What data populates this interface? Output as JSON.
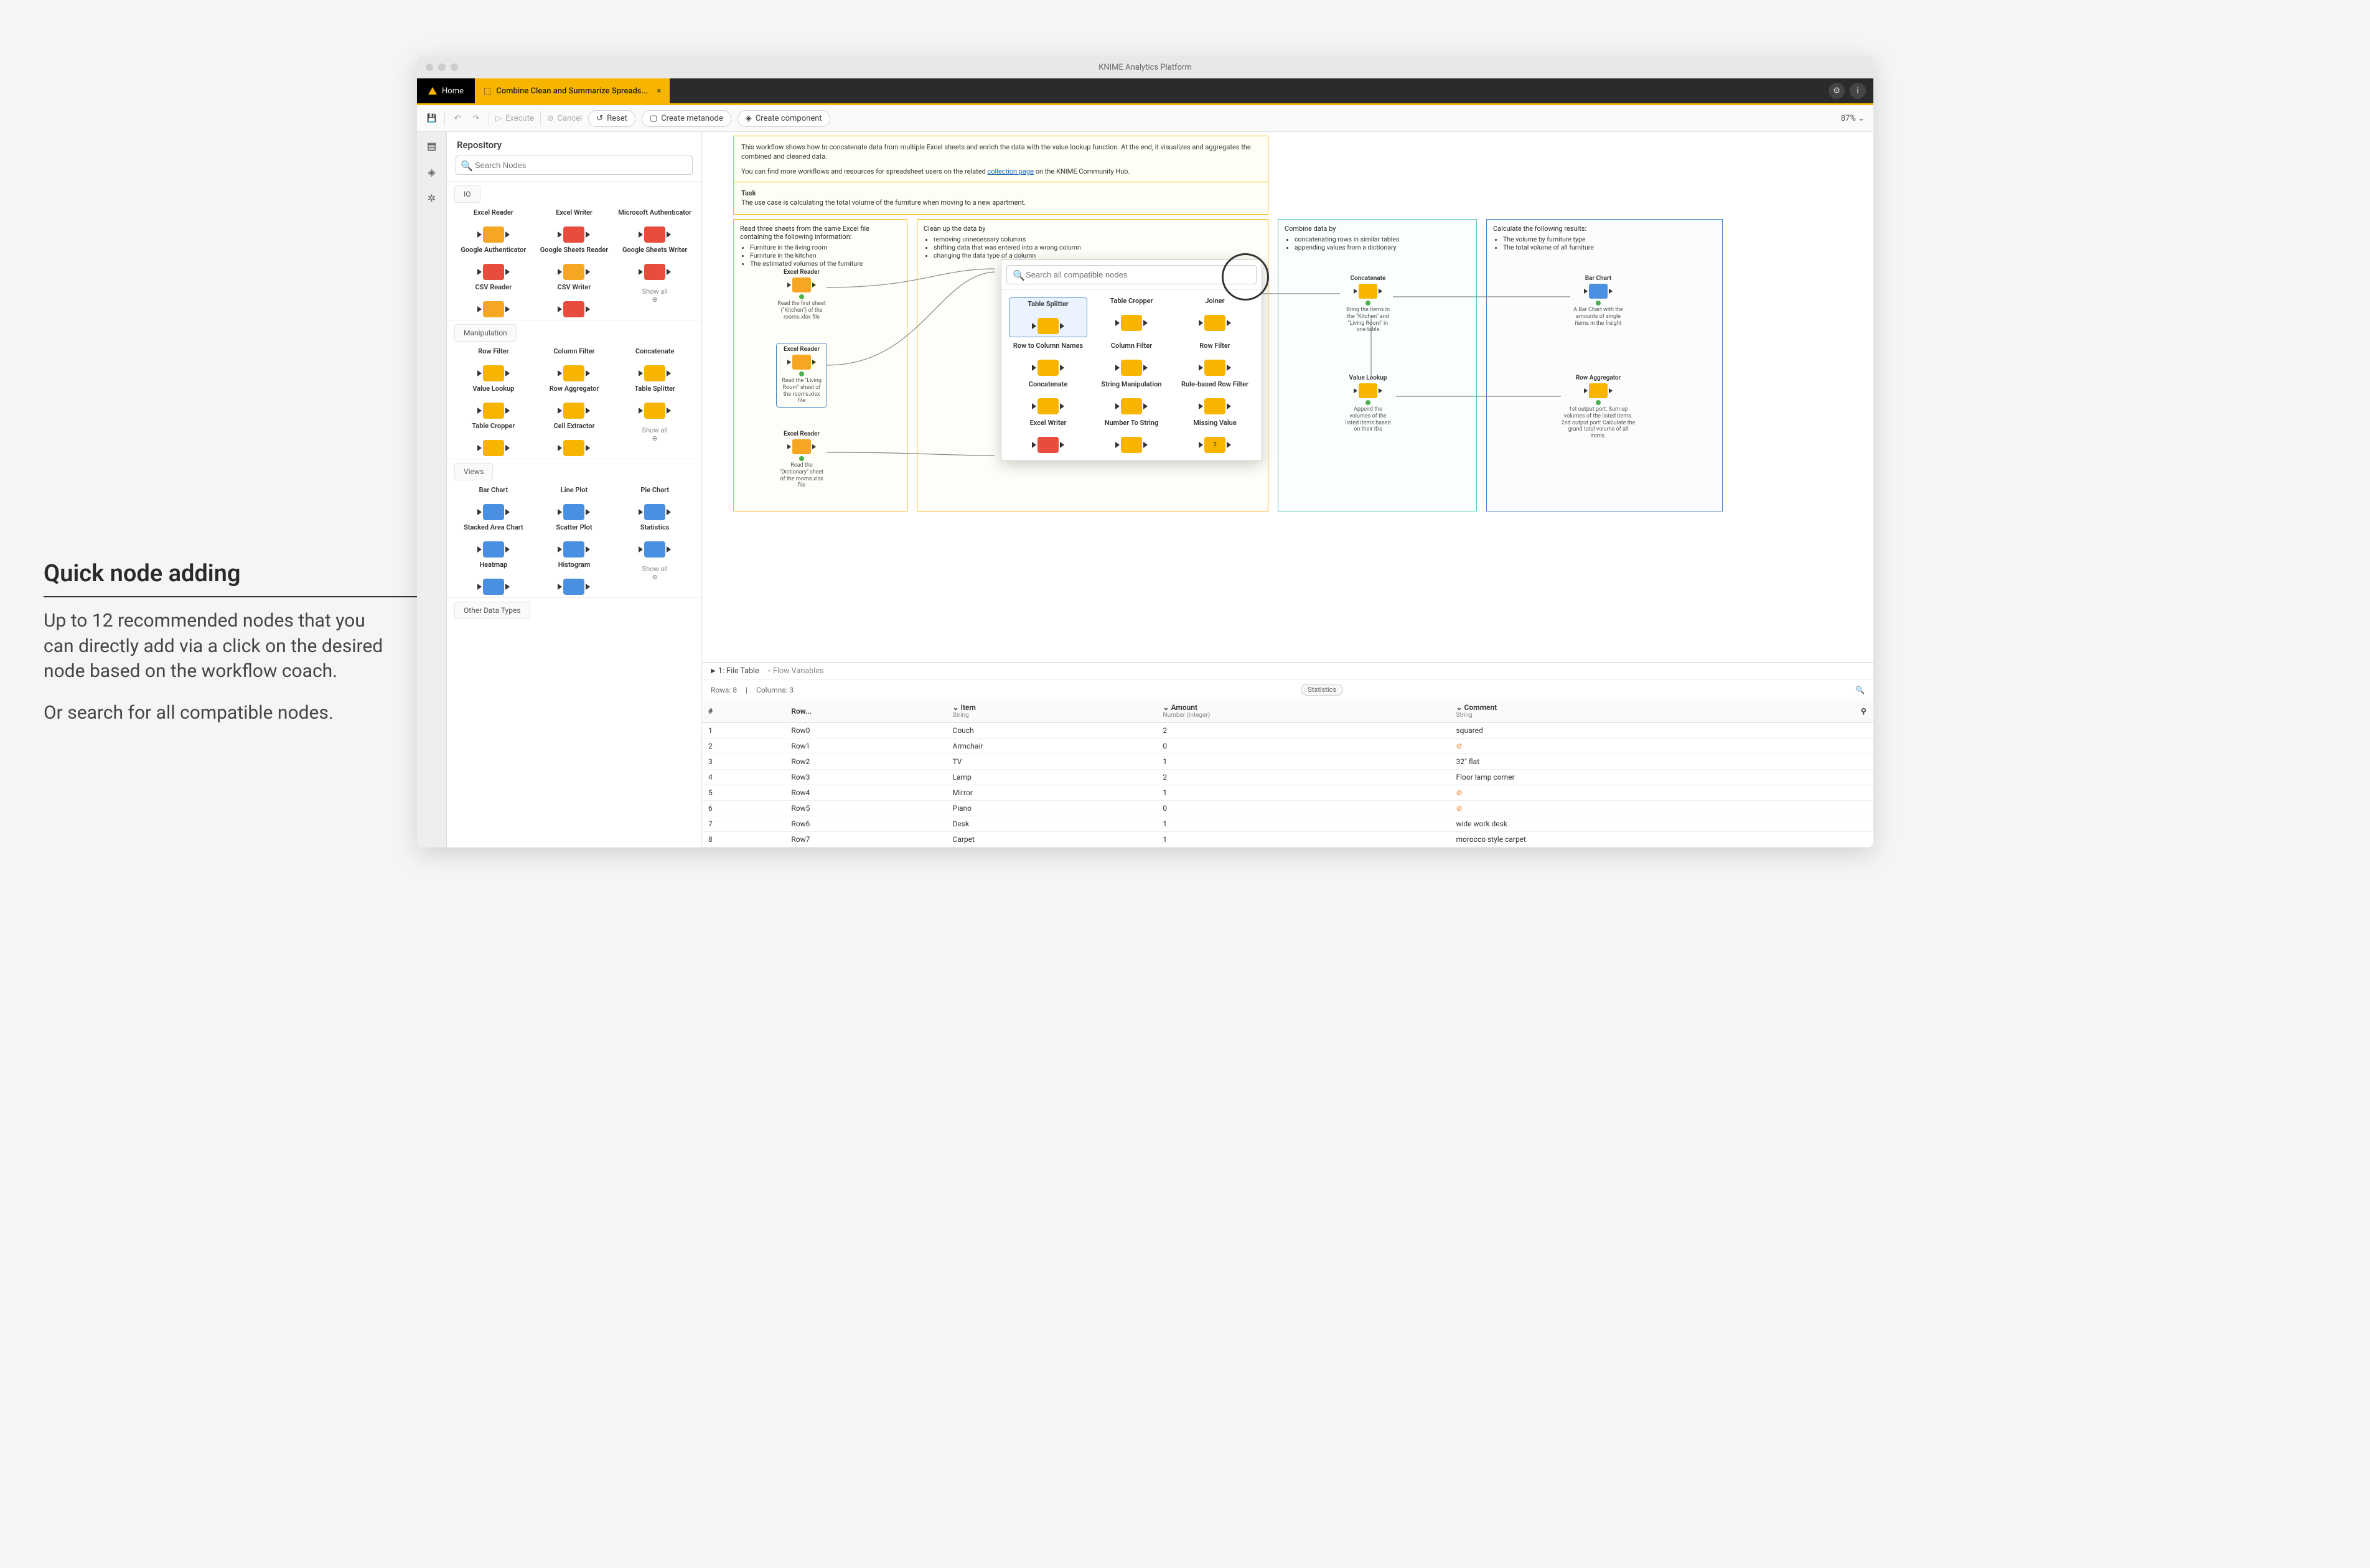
{
  "annotation": {
    "title": "Quick node adding",
    "p1": "Up to 12 recommended nodes that you can directly add via a click on the desired node based on the workflow coach.",
    "p2": "Or search for all compatible nodes."
  },
  "window": {
    "title": "KNIME Analytics Platform",
    "home": "Home",
    "workflow_tab": "Combine Clean and Summarize Spreads...",
    "zoom": "87% ",
    "toolbar": {
      "execute": "Execute",
      "cancel": "Cancel",
      "reset": "Reset",
      "create_metanode": "Create metanode",
      "create_component": "Create component"
    }
  },
  "sidebar": {
    "title": "Repository",
    "search_placeholder": "Search Nodes",
    "sections": {
      "io": "IO",
      "manipulation": "Manipulation",
      "views": "Views",
      "other": "Other Data Types"
    },
    "io_nodes": [
      "Excel Reader",
      "Excel Writer",
      "Microsoft Authenticator",
      "Google Authenticator",
      "Google Sheets Reader",
      "Google Sheets Writer",
      "CSV Reader",
      "CSV Writer"
    ],
    "manip_nodes": [
      "Row Filter",
      "Column Filter",
      "Concatenate",
      "Value Lookup",
      "Row Aggregator",
      "Table Splitter",
      "Table Cropper",
      "Cell Extractor"
    ],
    "view_nodes": [
      "Bar Chart",
      "Line Plot",
      "Pie Chart",
      "Stacked Area Chart",
      "Scatter Plot",
      "Statistics",
      "Heatmap",
      "Histogram"
    ],
    "show_all": "Show all"
  },
  "quickadd": {
    "search_placeholder": "Search all compatible nodes",
    "nodes": [
      "Table Splitter",
      "Table Cropper",
      "Joiner",
      "Row to Column Names",
      "Column Filter",
      "Row Filter",
      "Concatenate",
      "String Manipulation",
      "Rule-based Row Filter",
      "Excel Writer",
      "Number To String",
      "Missing Value"
    ]
  },
  "canvas": {
    "desc1a": "This workflow shows how to concatenate data from multiple Excel sheets and enrich the data with the value lookup function. At the end, it visualizes and aggregates the combined and cleaned data.",
    "desc1b_pre": "You can find more workflows and resources for spreadsheet users on the related ",
    "desc1b_link": "collection page",
    "desc1b_post": " on the KNIME Community Hub.",
    "task_label": "Task",
    "task_text": "The use case is calculating the total volume of the furniture when moving to a new apartment.",
    "sec1": {
      "title": "Read three sheets from the same Excel file containing the following information:",
      "items": [
        "Furniture in the living room",
        "Furniture in the kitchen",
        "The estimated volumes of the furniture"
      ]
    },
    "sec2": {
      "title": "Clean up the data by",
      "items": [
        "removing unnecessary columns",
        "shifting data that was entered into a wrong column",
        "changing the data type of a column"
      ]
    },
    "sec3": {
      "title": "Combine data by",
      "items": [
        "concatenating rows in similar tables",
        "appending values from a dictionary"
      ]
    },
    "sec4": {
      "title": "Calculate the following results:",
      "items": [
        "The volume by furniture type",
        "The total volume of all furniture"
      ]
    },
    "nodes": {
      "er1": {
        "t": "Excel Reader",
        "cap": "Read the first sheet (\"Kitchen\") of the rooms.xlsx file"
      },
      "er2": {
        "t": "Excel Reader",
        "cap": "Read the \"Living Room\" sheet of the rooms.xlsx file"
      },
      "er3": {
        "t": "Excel Reader",
        "cap": "Read the \"Dictionary\" sheet of the rooms.xlsx file"
      },
      "concat": {
        "t": "Concatenate",
        "cap": "Bring the items in the \"Kitchen\" and \"Living Room\" in one table"
      },
      "vlookup": {
        "t": "Value Lookup",
        "cap": "Append the volumes of the listed items based on their IDs"
      },
      "bar": {
        "t": "Bar Chart",
        "cap": "A Bar Chart with the amounts of single items in the freight"
      },
      "rowagg": {
        "t": "Row Aggregator",
        "cap": "1st output port: Sum up volumes of the listed items. 2nd output port: Calculate the grand total volume of all items."
      }
    }
  },
  "table": {
    "tab1": "1: File Table",
    "tab2": "Flow Variables",
    "rows_label": "Rows: 8",
    "cols_label": "Columns: 3",
    "stats": "Statistics",
    "headers": [
      {
        "h": "#",
        "sub": ""
      },
      {
        "h": "Row...",
        "sub": ""
      },
      {
        "h": "Item",
        "sub": "String"
      },
      {
        "h": "Amount",
        "sub": "Number (integer)"
      },
      {
        "h": "Comment",
        "sub": "String"
      }
    ],
    "rows": [
      [
        "1",
        "Row0",
        "Couch",
        "2",
        "squared"
      ],
      [
        "2",
        "Row1",
        "Armchair",
        "0",
        "⊘"
      ],
      [
        "3",
        "Row2",
        "TV",
        "1",
        "32\" flat"
      ],
      [
        "4",
        "Row3",
        "Lamp",
        "2",
        "Floor lamp corner"
      ],
      [
        "5",
        "Row4",
        "Mirror",
        "1",
        "⊘"
      ],
      [
        "6",
        "Row5",
        "Piano",
        "0",
        "⊘"
      ],
      [
        "7",
        "Row6",
        "Desk",
        "1",
        "wide work desk"
      ],
      [
        "8",
        "Row7",
        "Carpet",
        "1",
        "morocco style carpet"
      ]
    ]
  }
}
